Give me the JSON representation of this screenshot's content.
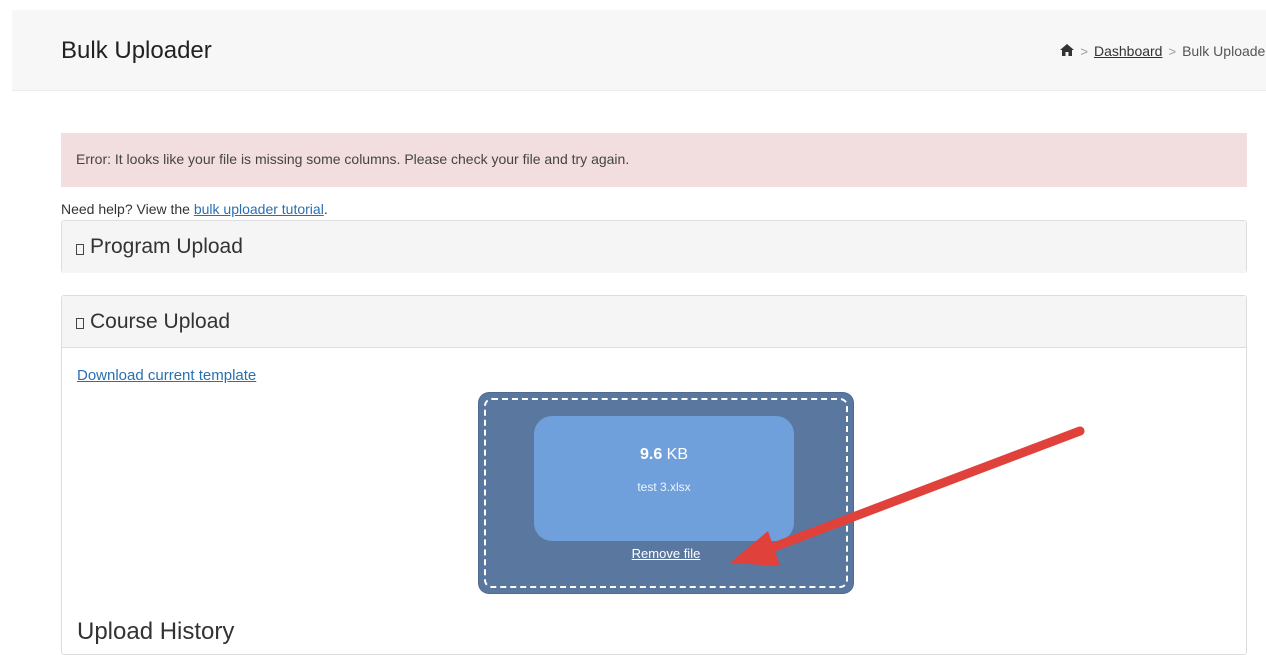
{
  "header": {
    "title": "Bulk Uploader",
    "breadcrumb": {
      "home_icon": "home-icon",
      "separator": ">",
      "items": [
        "Dashboard",
        "Bulk Uploader"
      ]
    }
  },
  "alert": {
    "message": "Error: It looks like your file is missing some columns. Please check your file and try again."
  },
  "help": {
    "prefix": "Need help? View the ",
    "link_text": "bulk uploader tutorial",
    "suffix": "."
  },
  "panels": {
    "program": {
      "title": "Program Upload"
    },
    "course": {
      "title": "Course Upload",
      "download_link": "Download current template",
      "dropzone": {
        "file_size_value": "9.6",
        "file_size_unit": "KB",
        "file_name": "test 3.xlsx",
        "remove_label": "Remove file"
      },
      "history_heading": "Upload History"
    }
  },
  "colors": {
    "alert_bg": "#f2dede",
    "dropzone_bg": "#5a77a0",
    "file_card_bg": "#6fa0db",
    "annotation_arrow": "#e0413a",
    "link": "#2a6fb0"
  }
}
